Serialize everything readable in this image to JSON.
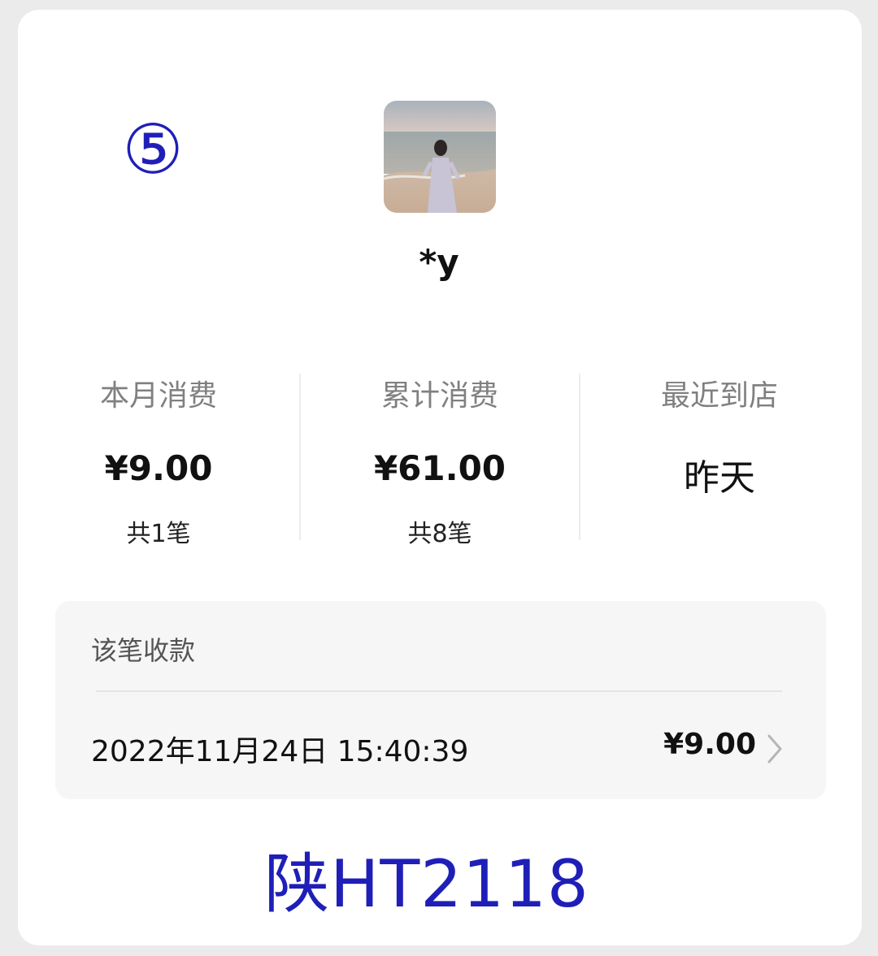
{
  "sequence_marker": "⑤",
  "user": {
    "avatar_icon": "beach-photo-avatar",
    "name": "*y"
  },
  "stats": [
    {
      "label": "本月消费",
      "value": "¥9.00",
      "count": "共1笔"
    },
    {
      "label": "累计消费",
      "value": "¥61.00",
      "count": "共8笔"
    },
    {
      "label": "最近到店",
      "value": "昨天"
    }
  ],
  "payment": {
    "title": "该笔收款",
    "transaction": {
      "time": "2022年11月24日 15:40:39",
      "amount": "¥9.00",
      "chevron_icon": "chevron-right-icon"
    }
  },
  "plate_text": "陕HT2118",
  "colors": {
    "annotation_blue": "#1f1fb8",
    "card_bg": "#ffffff",
    "page_bg": "#ebebeb"
  }
}
